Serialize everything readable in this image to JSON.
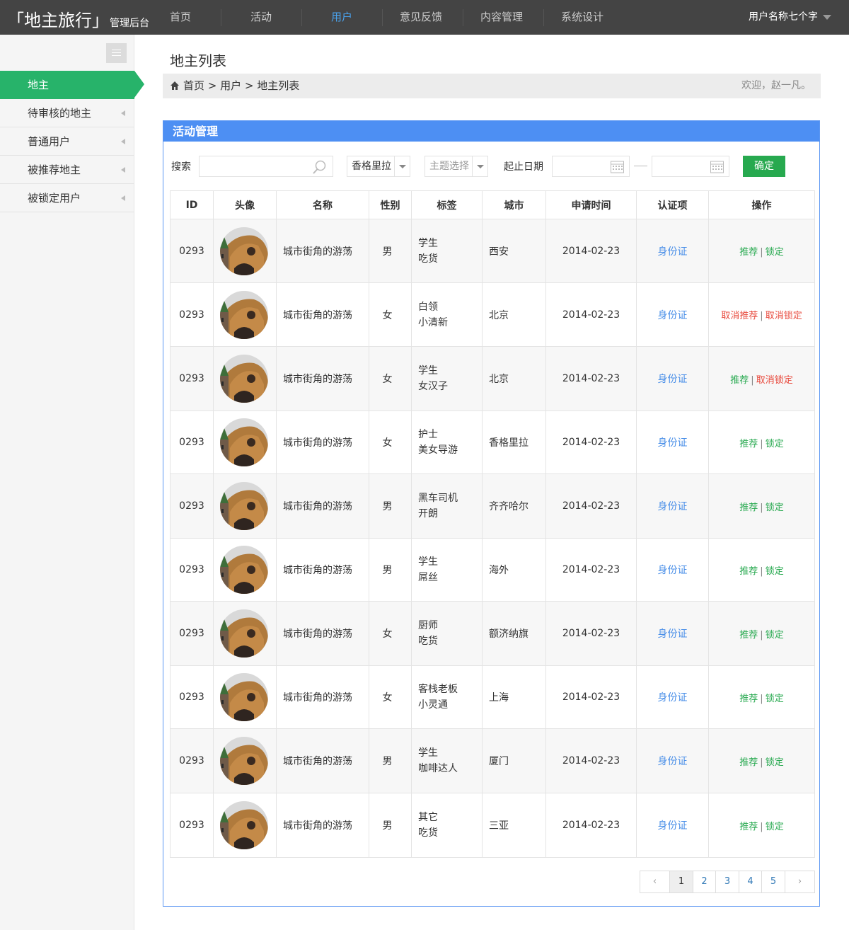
{
  "header": {
    "logo_main": "「地主旅行」",
    "logo_sub": "管理后台",
    "nav": [
      "首页",
      "活动",
      "用户",
      "意见反馈",
      "内容管理",
      "系统设计"
    ],
    "active_nav": "用户",
    "user_name": "用户名称七个字"
  },
  "sidebar": {
    "items": [
      {
        "label": "地主",
        "active": true
      },
      {
        "label": "待审核的地主"
      },
      {
        "label": "普通用户"
      },
      {
        "label": "被推荐地主"
      },
      {
        "label": "被锁定用户"
      }
    ]
  },
  "page": {
    "title": "地主列表",
    "breadcrumb": "首页 > 用户 > 地主列表",
    "welcome": "欢迎，赵一凡。"
  },
  "panel": {
    "title": "活动管理",
    "search_label": "搜索",
    "search_value": "",
    "city_select": "香格里拉",
    "theme_select": "主题选择",
    "date_label": "起止日期",
    "confirm_label": "确定"
  },
  "table": {
    "headers": [
      "ID",
      "头像",
      "名称",
      "性别",
      "标签",
      "城市",
      "申请时间",
      "认证项",
      "操作"
    ],
    "rows": [
      {
        "id": "0293",
        "name": "城市街角的游荡",
        "gender": "男",
        "tag1": "学生",
        "tag2": "吃货",
        "city": "西安",
        "date": "2014-02-23",
        "auth": "身份证",
        "op1": "推荐",
        "op1_color": "green",
        "op2": "锁定",
        "op2_color": "green"
      },
      {
        "id": "0293",
        "name": "城市街角的游荡",
        "gender": "女",
        "tag1": "白领",
        "tag2": "小清新",
        "city": "北京",
        "date": "2014-02-23",
        "auth": "身份证",
        "op1": "取消推荐",
        "op1_color": "red",
        "op2": "取消锁定",
        "op2_color": "red"
      },
      {
        "id": "0293",
        "name": "城市街角的游荡",
        "gender": "女",
        "tag1": "学生",
        "tag2": "女汉子",
        "city": "北京",
        "date": "2014-02-23",
        "auth": "身份证",
        "op1": "推荐",
        "op1_color": "green",
        "op2": "取消锁定",
        "op2_color": "red"
      },
      {
        "id": "0293",
        "name": "城市街角的游荡",
        "gender": "女",
        "tag1": "护士",
        "tag2": "美女导游",
        "city": "香格里拉",
        "date": "2014-02-23",
        "auth": "身份证",
        "op1": "推荐",
        "op1_color": "green",
        "op2": "锁定",
        "op2_color": "green"
      },
      {
        "id": "0293",
        "name": "城市街角的游荡",
        "gender": "男",
        "tag1": "黑车司机",
        "tag2": "开朗",
        "city": "齐齐哈尔",
        "date": "2014-02-23",
        "auth": "身份证",
        "op1": "推荐",
        "op1_color": "green",
        "op2": "锁定",
        "op2_color": "green"
      },
      {
        "id": "0293",
        "name": "城市街角的游荡",
        "gender": "男",
        "tag1": "学生",
        "tag2": "屌丝",
        "city": "海外",
        "date": "2014-02-23",
        "auth": "身份证",
        "op1": "推荐",
        "op1_color": "green",
        "op2": "锁定",
        "op2_color": "green"
      },
      {
        "id": "0293",
        "name": "城市街角的游荡",
        "gender": "女",
        "tag1": "厨师",
        "tag2": "吃货",
        "city": "额济纳旗",
        "date": "2014-02-23",
        "auth": "身份证",
        "op1": "推荐",
        "op1_color": "green",
        "op2": "锁定",
        "op2_color": "green"
      },
      {
        "id": "0293",
        "name": "城市街角的游荡",
        "gender": "女",
        "tag1": "客栈老板",
        "tag2": "小灵通",
        "city": "上海",
        "date": "2014-02-23",
        "auth": "身份证",
        "op1": "推荐",
        "op1_color": "green",
        "op2": "锁定",
        "op2_color": "green"
      },
      {
        "id": "0293",
        "name": "城市街角的游荡",
        "gender": "男",
        "tag1": "学生",
        "tag2": "咖啡达人",
        "city": "厦门",
        "date": "2014-02-23",
        "auth": "身份证",
        "op1": "推荐",
        "op1_color": "green",
        "op2": "锁定",
        "op2_color": "green"
      },
      {
        "id": "0293",
        "name": "城市街角的游荡",
        "gender": "男",
        "tag1": "其它",
        "tag2": "吃货",
        "city": "三亚",
        "date": "2014-02-23",
        "auth": "身份证",
        "op1": "推荐",
        "op1_color": "green",
        "op2": "锁定",
        "op2_color": "green"
      }
    ]
  },
  "pagination": {
    "prev": "‹",
    "pages": [
      "1",
      "2",
      "3",
      "4",
      "5"
    ],
    "current": "1",
    "next": "›"
  },
  "colors": {
    "topbar": "#444444",
    "active_nav": "#4aa3ee",
    "sidebar_active": "#27b36a",
    "panel_blue": "#4d8ff3",
    "confirm_green": "#27a94f",
    "op_green": "#27a94f",
    "op_red": "#e8493c",
    "auth_blue": "#4a8fe8"
  },
  "icons": {
    "home": "home-icon",
    "menu": "menu-icon",
    "search": "search-icon",
    "calendar": "calendar-icon",
    "caret": "caret-down-icon",
    "chevron": "chevron-left-icon"
  }
}
